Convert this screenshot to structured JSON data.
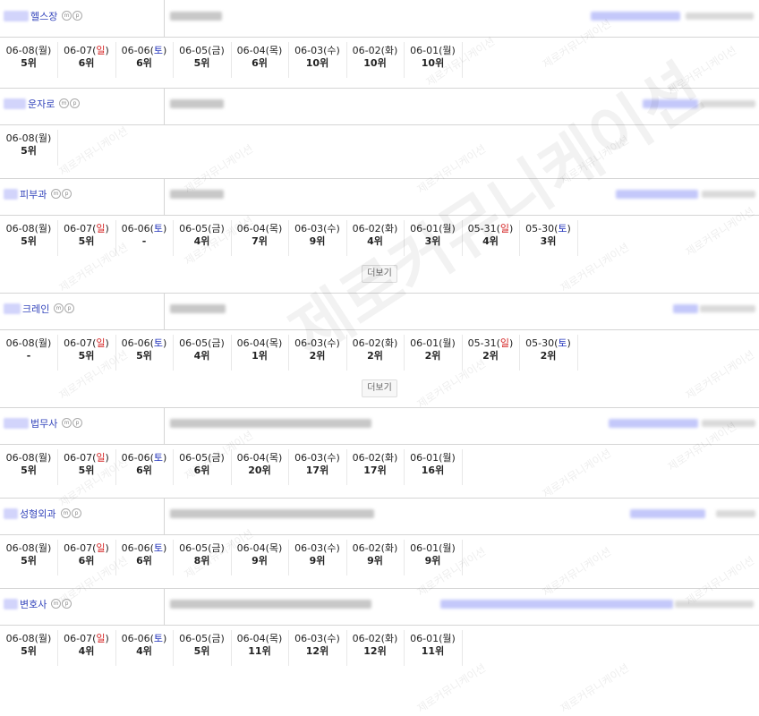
{
  "watermark": "제로커뮤니케이션",
  "more_label": "더보기",
  "keywords": [
    {
      "name": "헬스장",
      "days": [
        {
          "date": "06-08",
          "dow": "월",
          "rank": "5위"
        },
        {
          "date": "06-07",
          "dow": "일",
          "rank": "6위"
        },
        {
          "date": "06-06",
          "dow": "토",
          "rank": "6위"
        },
        {
          "date": "06-05",
          "dow": "금",
          "rank": "5위"
        },
        {
          "date": "06-04",
          "dow": "목",
          "rank": "6위"
        },
        {
          "date": "06-03",
          "dow": "수",
          "rank": "10위"
        },
        {
          "date": "06-02",
          "dow": "화",
          "rank": "10위"
        },
        {
          "date": "06-01",
          "dow": "월",
          "rank": "10위"
        }
      ]
    },
    {
      "name": "운자로",
      "days": [
        {
          "date": "06-08",
          "dow": "월",
          "rank": "5위"
        }
      ]
    },
    {
      "name": "피부과",
      "has_more": true,
      "days": [
        {
          "date": "06-08",
          "dow": "월",
          "rank": "5위"
        },
        {
          "date": "06-07",
          "dow": "일",
          "rank": "5위"
        },
        {
          "date": "06-06",
          "dow": "토",
          "rank": "-"
        },
        {
          "date": "06-05",
          "dow": "금",
          "rank": "4위"
        },
        {
          "date": "06-04",
          "dow": "목",
          "rank": "7위"
        },
        {
          "date": "06-03",
          "dow": "수",
          "rank": "9위"
        },
        {
          "date": "06-02",
          "dow": "화",
          "rank": "4위"
        },
        {
          "date": "06-01",
          "dow": "월",
          "rank": "3위"
        },
        {
          "date": "05-31",
          "dow": "일",
          "rank": "4위"
        },
        {
          "date": "05-30",
          "dow": "토",
          "rank": "3위"
        }
      ]
    },
    {
      "name": "크레인",
      "has_more": true,
      "days": [
        {
          "date": "06-08",
          "dow": "월",
          "rank": "-"
        },
        {
          "date": "06-07",
          "dow": "일",
          "rank": "5위"
        },
        {
          "date": "06-06",
          "dow": "토",
          "rank": "5위"
        },
        {
          "date": "06-05",
          "dow": "금",
          "rank": "4위"
        },
        {
          "date": "06-04",
          "dow": "목",
          "rank": "1위"
        },
        {
          "date": "06-03",
          "dow": "수",
          "rank": "2위"
        },
        {
          "date": "06-02",
          "dow": "화",
          "rank": "2위"
        },
        {
          "date": "06-01",
          "dow": "월",
          "rank": "2위"
        },
        {
          "date": "05-31",
          "dow": "일",
          "rank": "2위"
        },
        {
          "date": "05-30",
          "dow": "토",
          "rank": "2위"
        }
      ]
    },
    {
      "name": "법무사",
      "days": [
        {
          "date": "06-08",
          "dow": "월",
          "rank": "5위"
        },
        {
          "date": "06-07",
          "dow": "일",
          "rank": "5위"
        },
        {
          "date": "06-06",
          "dow": "토",
          "rank": "6위"
        },
        {
          "date": "06-05",
          "dow": "금",
          "rank": "6위"
        },
        {
          "date": "06-04",
          "dow": "목",
          "rank": "20위"
        },
        {
          "date": "06-03",
          "dow": "수",
          "rank": "17위"
        },
        {
          "date": "06-02",
          "dow": "화",
          "rank": "17위"
        },
        {
          "date": "06-01",
          "dow": "월",
          "rank": "16위"
        }
      ]
    },
    {
      "name": "성형외과",
      "days": [
        {
          "date": "06-08",
          "dow": "월",
          "rank": "5위"
        },
        {
          "date": "06-07",
          "dow": "일",
          "rank": "6위"
        },
        {
          "date": "06-06",
          "dow": "토",
          "rank": "6위"
        },
        {
          "date": "06-05",
          "dow": "금",
          "rank": "8위"
        },
        {
          "date": "06-04",
          "dow": "목",
          "rank": "9위"
        },
        {
          "date": "06-03",
          "dow": "수",
          "rank": "9위"
        },
        {
          "date": "06-02",
          "dow": "화",
          "rank": "9위"
        },
        {
          "date": "06-01",
          "dow": "월",
          "rank": "9위"
        }
      ]
    },
    {
      "name": "변호사",
      "days": [
        {
          "date": "06-08",
          "dow": "월",
          "rank": "5위"
        },
        {
          "date": "06-07",
          "dow": "일",
          "rank": "4위"
        },
        {
          "date": "06-06",
          "dow": "토",
          "rank": "4위"
        },
        {
          "date": "06-05",
          "dow": "금",
          "rank": "5위"
        },
        {
          "date": "06-04",
          "dow": "목",
          "rank": "11위"
        },
        {
          "date": "06-03",
          "dow": "수",
          "rank": "12위"
        },
        {
          "date": "06-02",
          "dow": "화",
          "rank": "12위"
        },
        {
          "date": "06-01",
          "dow": "월",
          "rank": "11위"
        }
      ]
    }
  ]
}
